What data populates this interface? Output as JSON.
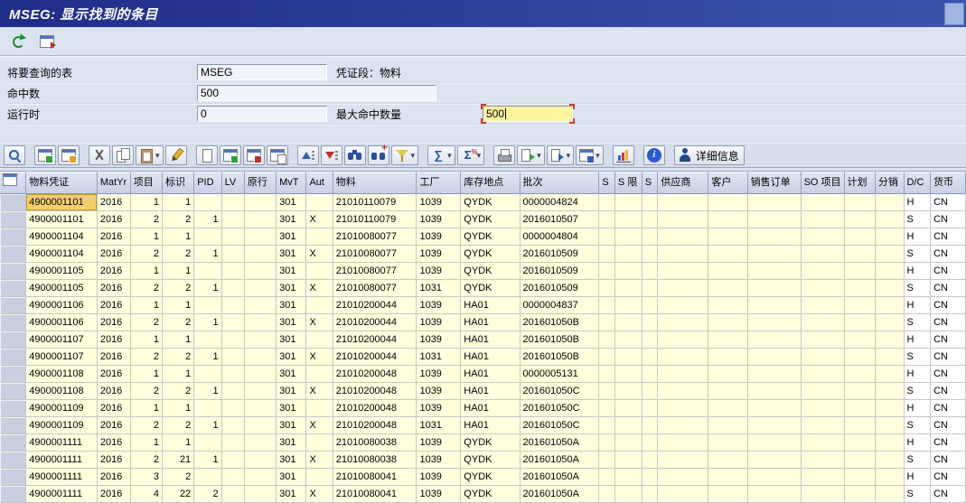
{
  "window": {
    "title": "MSEG:  显示找到的条目"
  },
  "colors": {
    "titlebar": "#1f2d87",
    "header_bg": "#ccd4e8",
    "cell_bg": "#ffffde",
    "cursor_cell_bg": "#f1ce6a",
    "focus_field_bg": "#fff3a0",
    "focus_corner": "#e03434"
  },
  "app_toolbar": {
    "items": [
      {
        "name": "refresh",
        "icon": "refresh"
      },
      {
        "name": "display-variant",
        "icon": "table-arrow"
      }
    ]
  },
  "form": {
    "table_label": "将要查询的表",
    "table_value": "MSEG",
    "segment_label": "凭证段：物料",
    "hits_label": "命中数",
    "hits_value": "500",
    "runtime_label": "运行时",
    "runtime_value": "0",
    "max_hits_label": "最大命中数量",
    "max_hits_value": "500"
  },
  "alv_toolbar": {
    "items": [
      {
        "name": "choose-detail",
        "icon": "magnifier"
      },
      {
        "type": "separator"
      },
      {
        "name": "check-entries",
        "icon": "table-check"
      },
      {
        "name": "refresh-list",
        "icon": "table-refresh"
      },
      {
        "type": "separator"
      },
      {
        "name": "cut",
        "icon": "scissors"
      },
      {
        "name": "copy",
        "icon": "copy"
      },
      {
        "name": "paste",
        "icon": "paste",
        "dropdown": true
      },
      {
        "name": "clear",
        "icon": "pencil"
      },
      {
        "type": "separator"
      },
      {
        "name": "create-entry",
        "icon": "page"
      },
      {
        "name": "insert-row",
        "icon": "table-insert"
      },
      {
        "name": "delete-row",
        "icon": "table-delete"
      },
      {
        "name": "copy-row",
        "icon": "table-copy"
      },
      {
        "type": "separator"
      },
      {
        "name": "sort-ascending",
        "icon": "sort-asc"
      },
      {
        "name": "sort-descending",
        "icon": "sort-desc"
      },
      {
        "name": "find",
        "icon": "binoculars"
      },
      {
        "name": "find-next",
        "icon": "binoculars-plus"
      },
      {
        "name": "set-filter",
        "icon": "funnel",
        "dropdown": true
      },
      {
        "type": "separator"
      },
      {
        "name": "total",
        "icon": "sum",
        "glyph": "∑",
        "dropdown": true
      },
      {
        "name": "subtotal",
        "icon": "percent-sum",
        "glyph": "Σ",
        "dropdown": true
      },
      {
        "type": "separator"
      },
      {
        "name": "print",
        "icon": "printer"
      },
      {
        "name": "export",
        "icon": "export",
        "dropdown": true
      },
      {
        "name": "local-file",
        "icon": "export-file",
        "dropdown": true
      },
      {
        "name": "choose-layout",
        "icon": "table-layout",
        "dropdown": true
      },
      {
        "type": "separator"
      },
      {
        "name": "graphic",
        "icon": "chart"
      },
      {
        "type": "separator"
      },
      {
        "name": "info",
        "icon": "info"
      },
      {
        "type": "separator"
      },
      {
        "name": "details",
        "icon": "person",
        "label": "详细信息"
      }
    ]
  },
  "table": {
    "selector_col_width": 30,
    "cursor_cell": {
      "row": 0,
      "col": 0
    },
    "columns": [
      {
        "key": "mblnr",
        "label": "物料凭证",
        "width": 80,
        "align": "left",
        "tone": "yellow"
      },
      {
        "key": "mjahr",
        "label": "MatYr",
        "width": 37,
        "align": "left",
        "tone": "yellow"
      },
      {
        "key": "zeile",
        "label": "项目",
        "width": 36,
        "align": "right",
        "tone": "yellow"
      },
      {
        "key": "flag",
        "label": "标识",
        "width": 36,
        "align": "right",
        "tone": "yellow"
      },
      {
        "key": "pid",
        "label": "PID",
        "width": 31,
        "align": "right",
        "tone": "yellow"
      },
      {
        "key": "lv",
        "label": "LV",
        "width": 26,
        "align": "left",
        "tone": "yellow"
      },
      {
        "key": "origln",
        "label": "原行",
        "width": 36,
        "align": "left",
        "tone": "yellow"
      },
      {
        "key": "mvt",
        "label": "MvT",
        "width": 34,
        "align": "left",
        "tone": "yellow"
      },
      {
        "key": "aut",
        "label": "Aut",
        "width": 30,
        "align": "left",
        "tone": "yellow"
      },
      {
        "key": "matnr",
        "label": "物料",
        "width": 95,
        "align": "left",
        "tone": "yellow"
      },
      {
        "key": "werks",
        "label": "工厂",
        "width": 51,
        "align": "left",
        "tone": "yellow"
      },
      {
        "key": "lgort",
        "label": "库存地点",
        "width": 67,
        "align": "left",
        "tone": "yellow"
      },
      {
        "key": "charg",
        "label": "批次",
        "width": 90,
        "align": "left",
        "tone": "yellow"
      },
      {
        "key": "s1",
        "label": "S",
        "width": 18,
        "align": "left",
        "tone": "yellow"
      },
      {
        "key": "slim",
        "label": "S 限",
        "width": 30,
        "align": "left",
        "tone": "yellow"
      },
      {
        "key": "s2",
        "label": "S",
        "width": 18,
        "align": "left",
        "tone": "yellow"
      },
      {
        "key": "lifnr",
        "label": "供应商",
        "width": 58,
        "align": "left",
        "tone": "yellow"
      },
      {
        "key": "kunnr",
        "label": "客户",
        "width": 45,
        "align": "left",
        "tone": "yellow"
      },
      {
        "key": "kdauf",
        "label": "销售订单",
        "width": 60,
        "align": "left",
        "tone": "yellow"
      },
      {
        "key": "kdpos",
        "label": "SO 项目",
        "width": 46,
        "align": "left",
        "tone": "yellow"
      },
      {
        "key": "plan",
        "label": "计划",
        "width": 35,
        "align": "left",
        "tone": "yellow"
      },
      {
        "key": "distr",
        "label": "分销",
        "width": 32,
        "align": "left",
        "tone": "yellow"
      },
      {
        "key": "dc",
        "label": "D/C",
        "width": 30,
        "align": "left",
        "tone": "white"
      },
      {
        "key": "curr",
        "label": "货币",
        "width": 40,
        "align": "left",
        "tone": "white"
      }
    ],
    "rows": [
      [
        "4900001101",
        "2016",
        "1",
        "1",
        "",
        "",
        "",
        "301",
        "",
        "21010110079",
        "1039",
        "QYDK",
        "0000004824",
        "",
        "",
        "",
        "",
        "",
        "",
        "",
        "",
        "",
        "H",
        "CN"
      ],
      [
        "4900001101",
        "2016",
        "2",
        "2",
        "1",
        "",
        "",
        "301",
        "X",
        "21010110079",
        "1039",
        "QYDK",
        "2016010507",
        "",
        "",
        "",
        "",
        "",
        "",
        "",
        "",
        "",
        "S",
        "CN"
      ],
      [
        "4900001104",
        "2016",
        "1",
        "1",
        "",
        "",
        "",
        "301",
        "",
        "21010080077",
        "1039",
        "QYDK",
        "0000004804",
        "",
        "",
        "",
        "",
        "",
        "",
        "",
        "",
        "",
        "H",
        "CN"
      ],
      [
        "4900001104",
        "2016",
        "2",
        "2",
        "1",
        "",
        "",
        "301",
        "X",
        "21010080077",
        "1039",
        "QYDK",
        "2016010509",
        "",
        "",
        "",
        "",
        "",
        "",
        "",
        "",
        "",
        "S",
        "CN"
      ],
      [
        "4900001105",
        "2016",
        "1",
        "1",
        "",
        "",
        "",
        "301",
        "",
        "21010080077",
        "1039",
        "QYDK",
        "2016010509",
        "",
        "",
        "",
        "",
        "",
        "",
        "",
        "",
        "",
        "H",
        "CN"
      ],
      [
        "4900001105",
        "2016",
        "2",
        "2",
        "1",
        "",
        "",
        "301",
        "X",
        "21010080077",
        "1031",
        "QYDK",
        "2016010509",
        "",
        "",
        "",
        "",
        "",
        "",
        "",
        "",
        "",
        "S",
        "CN"
      ],
      [
        "4900001106",
        "2016",
        "1",
        "1",
        "",
        "",
        "",
        "301",
        "",
        "21010200044",
        "1039",
        "HA01",
        "0000004837",
        "",
        "",
        "",
        "",
        "",
        "",
        "",
        "",
        "",
        "H",
        "CN"
      ],
      [
        "4900001106",
        "2016",
        "2",
        "2",
        "1",
        "",
        "",
        "301",
        "X",
        "21010200044",
        "1039",
        "HA01",
        "201601050B",
        "",
        "",
        "",
        "",
        "",
        "",
        "",
        "",
        "",
        "S",
        "CN"
      ],
      [
        "4900001107",
        "2016",
        "1",
        "1",
        "",
        "",
        "",
        "301",
        "",
        "21010200044",
        "1039",
        "HA01",
        "201601050B",
        "",
        "",
        "",
        "",
        "",
        "",
        "",
        "",
        "",
        "H",
        "CN"
      ],
      [
        "4900001107",
        "2016",
        "2",
        "2",
        "1",
        "",
        "",
        "301",
        "X",
        "21010200044",
        "1031",
        "HA01",
        "201601050B",
        "",
        "",
        "",
        "",
        "",
        "",
        "",
        "",
        "",
        "S",
        "CN"
      ],
      [
        "4900001108",
        "2016",
        "1",
        "1",
        "",
        "",
        "",
        "301",
        "",
        "21010200048",
        "1039",
        "HA01",
        "0000005131",
        "",
        "",
        "",
        "",
        "",
        "",
        "",
        "",
        "",
        "H",
        "CN"
      ],
      [
        "4900001108",
        "2016",
        "2",
        "2",
        "1",
        "",
        "",
        "301",
        "X",
        "21010200048",
        "1039",
        "HA01",
        "201601050C",
        "",
        "",
        "",
        "",
        "",
        "",
        "",
        "",
        "",
        "S",
        "CN"
      ],
      [
        "4900001109",
        "2016",
        "1",
        "1",
        "",
        "",
        "",
        "301",
        "",
        "21010200048",
        "1039",
        "HA01",
        "201601050C",
        "",
        "",
        "",
        "",
        "",
        "",
        "",
        "",
        "",
        "H",
        "CN"
      ],
      [
        "4900001109",
        "2016",
        "2",
        "2",
        "1",
        "",
        "",
        "301",
        "X",
        "21010200048",
        "1031",
        "HA01",
        "201601050C",
        "",
        "",
        "",
        "",
        "",
        "",
        "",
        "",
        "",
        "S",
        "CN"
      ],
      [
        "4900001111",
        "2016",
        "1",
        "1",
        "",
        "",
        "",
        "301",
        "",
        "21010080038",
        "1039",
        "QYDK",
        "201601050A",
        "",
        "",
        "",
        "",
        "",
        "",
        "",
        "",
        "",
        "H",
        "CN"
      ],
      [
        "4900001111",
        "2016",
        "2",
        "21",
        "1",
        "",
        "",
        "301",
        "X",
        "21010080038",
        "1039",
        "QYDK",
        "201601050A",
        "",
        "",
        "",
        "",
        "",
        "",
        "",
        "",
        "",
        "S",
        "CN"
      ],
      [
        "4900001111",
        "2016",
        "3",
        "2",
        "",
        "",
        "",
        "301",
        "",
        "21010080041",
        "1039",
        "QYDK",
        "201601050A",
        "",
        "",
        "",
        "",
        "",
        "",
        "",
        "",
        "",
        "H",
        "CN"
      ],
      [
        "4900001111",
        "2016",
        "4",
        "22",
        "2",
        "",
        "",
        "301",
        "X",
        "21010080041",
        "1039",
        "QYDK",
        "201601050A",
        "",
        "",
        "",
        "",
        "",
        "",
        "",
        "",
        "",
        "S",
        "CN"
      ]
    ]
  }
}
